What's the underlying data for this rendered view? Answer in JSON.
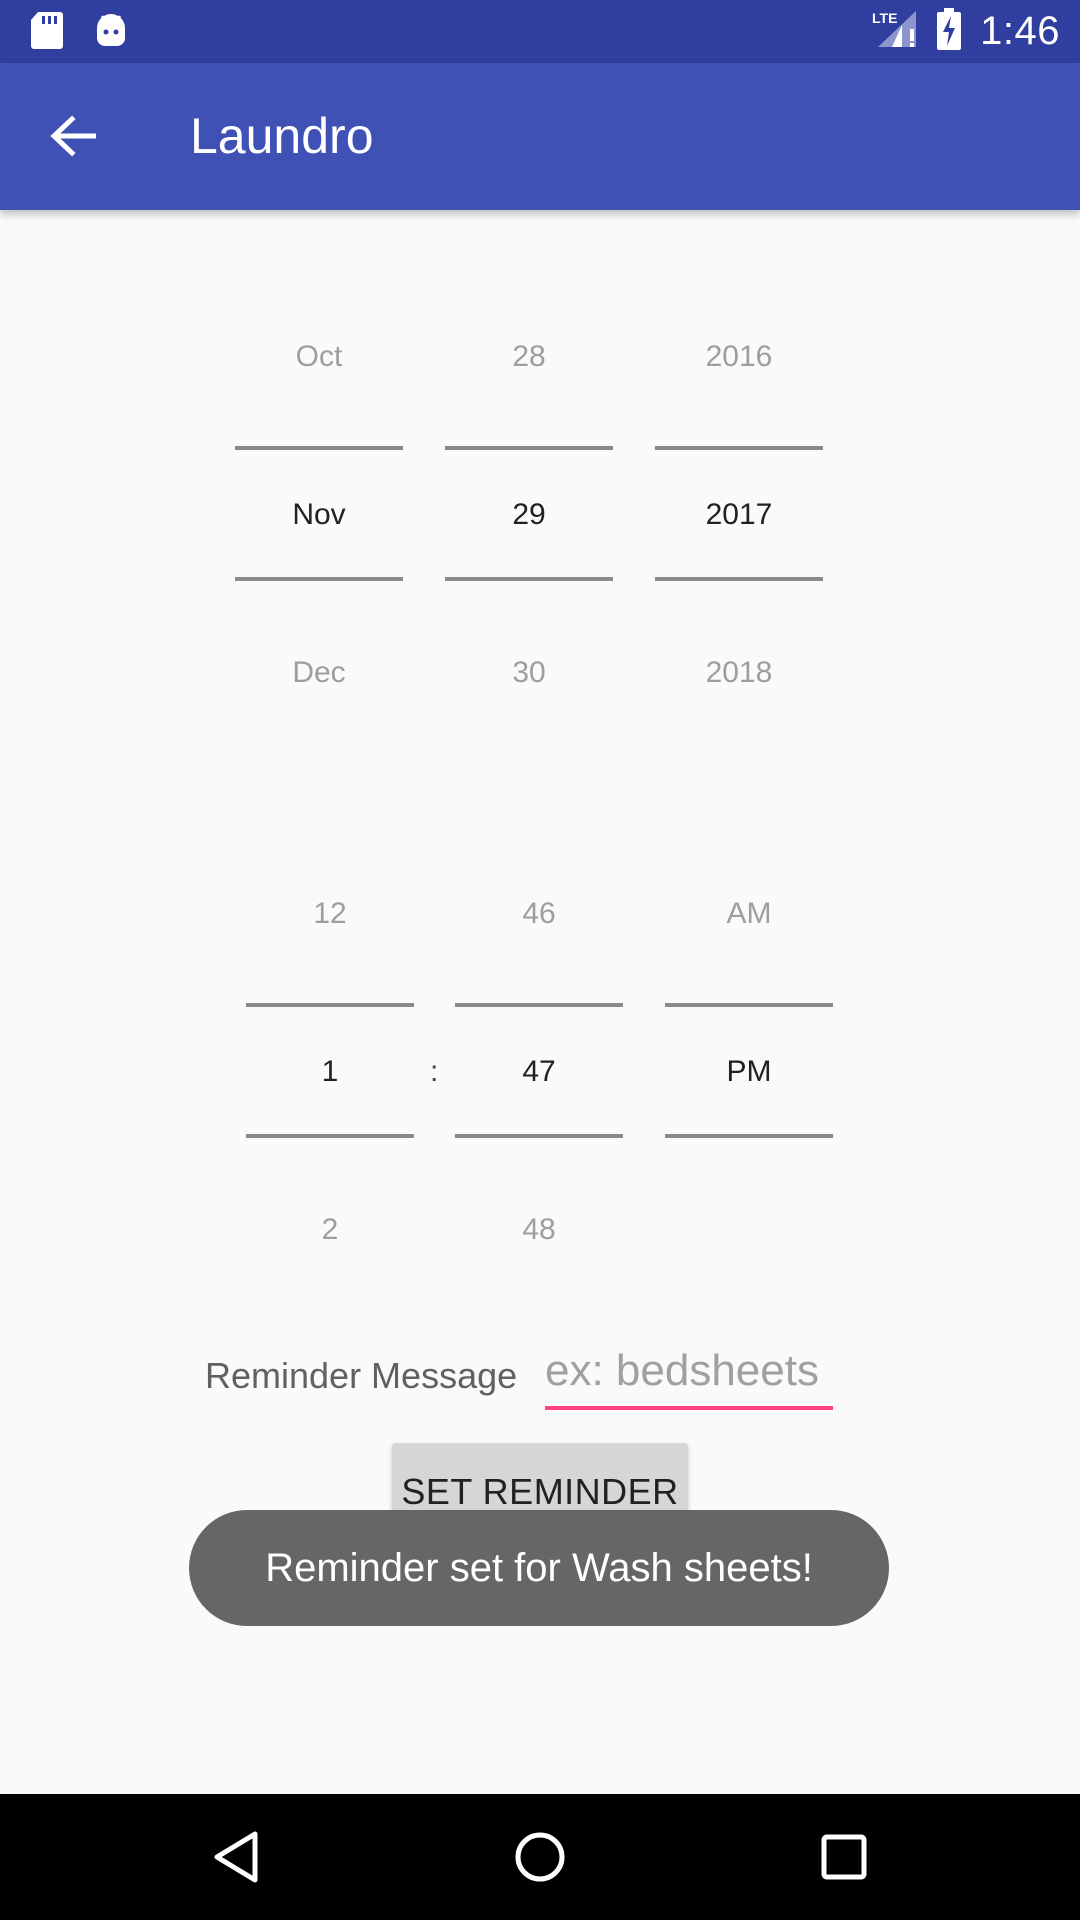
{
  "status_bar": {
    "time": "1:46",
    "network": "LTE",
    "icons": [
      "sd-card-icon",
      "android-icon",
      "signal-icon",
      "battery-charging-icon"
    ]
  },
  "app_bar": {
    "title": "Laundro",
    "back_icon": "arrow-back-icon"
  },
  "date_picker": {
    "month": {
      "prev": "Oct",
      "selected": "Nov",
      "next": "Dec"
    },
    "day": {
      "prev": "28",
      "selected": "29",
      "next": "30"
    },
    "year": {
      "prev": "2016",
      "selected": "2017",
      "next": "2018"
    }
  },
  "time_picker": {
    "hour": {
      "prev": "12",
      "selected": "1",
      "next": "2"
    },
    "separator": ":",
    "minute": {
      "prev": "46",
      "selected": "47",
      "next": "48"
    },
    "ampm": {
      "prev": "AM",
      "selected": "PM",
      "next": ""
    }
  },
  "reminder": {
    "label": "Reminder Message",
    "placeholder": "ex: bedsheets",
    "value": ""
  },
  "button": {
    "label": "SET REMINDER"
  },
  "toast": {
    "message": "Reminder set for Wash sheets!"
  },
  "nav_bar": {
    "icons": [
      "back-triangle-icon",
      "home-circle-icon",
      "recents-square-icon"
    ]
  },
  "colors": {
    "status_bar": "#303f9f",
    "app_bar": "#3f51b5",
    "accent": "#ff4081",
    "background": "#fafafa"
  }
}
